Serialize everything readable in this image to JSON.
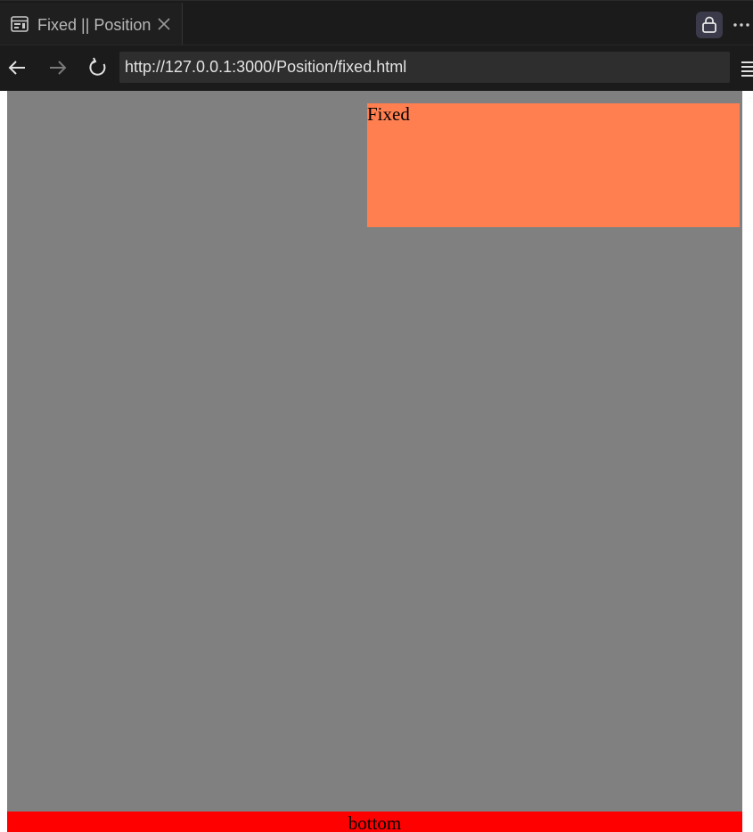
{
  "browser": {
    "tab": {
      "title": "Fixed || Position",
      "icon": "page-icon",
      "close_icon": "close-icon"
    },
    "toolbar": {
      "lock_icon": "lock-icon",
      "more_icon": "more-icon"
    },
    "nav": {
      "back_icon": "back-arrow-icon",
      "forward_icon": "forward-arrow-icon",
      "reload_icon": "reload-icon",
      "url": "http://127.0.0.1:3000/Position/fixed.html",
      "menu_icon": "menu-icon"
    }
  },
  "page": {
    "background_color": "#808080",
    "fixed_box": {
      "label": "Fixed",
      "color": "#ff7f50"
    },
    "bottom_bar": {
      "label": "bottom",
      "color": "#ff0000"
    }
  }
}
